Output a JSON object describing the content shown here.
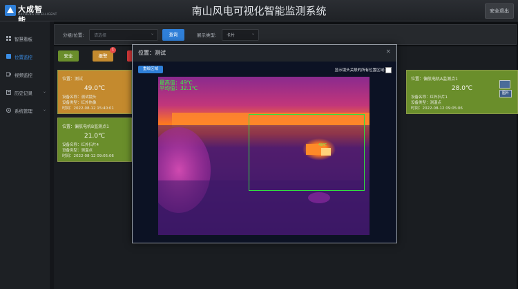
{
  "header": {
    "logo_text": "大成智能",
    "logo_sub": "DACHENG INTELLIGENT",
    "title": "南山风电可视化智能监测系统",
    "logout_label": "安全退出"
  },
  "sidebar": {
    "items": [
      {
        "label": "智慧看板",
        "icon": "dashboard-icon",
        "active": false
      },
      {
        "label": "位置监控",
        "icon": "location-icon",
        "active": true
      },
      {
        "label": "视频监控",
        "icon": "video-icon",
        "active": false
      },
      {
        "label": "历史记录",
        "icon": "history-icon",
        "active": false
      },
      {
        "label": "系统管理",
        "icon": "gear-icon",
        "active": false
      }
    ]
  },
  "filter": {
    "group_label": "分组/位置:",
    "group_placeholder": "请选择",
    "query_label": "查询",
    "display_label": "展示类型:",
    "display_value": "卡片"
  },
  "status_buttons": {
    "safe_label": "安全",
    "warn_label": "报警",
    "warn_badge": "1"
  },
  "cards": [
    {
      "location": "位置：测试",
      "temp": "49.0℃",
      "device_name": "设备名称：测试镜头",
      "device_type": "设备类型：红外热像",
      "time": "时间：2022-08-12 15:40:01",
      "color": "#c48a2e"
    },
    {
      "location": "位置：偏航电机A监测点1",
      "temp": "28.0℃",
      "device_name": "设备名称：红外扫片1",
      "device_type": "设备类型：测温点",
      "time": "时间：2022-08-12 09:05:06",
      "color": "#6a8e2b",
      "image_label": "图片"
    },
    {
      "location": "位置：偏航电机B监测点1",
      "temp": "21.0℃",
      "device_name": "设备名称：红外扫片4",
      "device_type": "设备类型：测温点",
      "time": "时间：2022-08-12 09:05:06",
      "color": "#6a8e2b"
    }
  ],
  "modal": {
    "title": "位置：测试",
    "close_glyph": "×",
    "draw_label": "重绘区域",
    "show_label": "显示镜头关联的所有位置区域:",
    "max_text": "最高值：49℃",
    "avg_text": "平均值：32.1℃",
    "roi_temp": "49℃"
  },
  "colors": {
    "accent": "#2f7fd8",
    "safe": "#6a8e2b",
    "warn": "#c48a2e",
    "alarm": "#d93a3a",
    "roi": "#31e040"
  }
}
